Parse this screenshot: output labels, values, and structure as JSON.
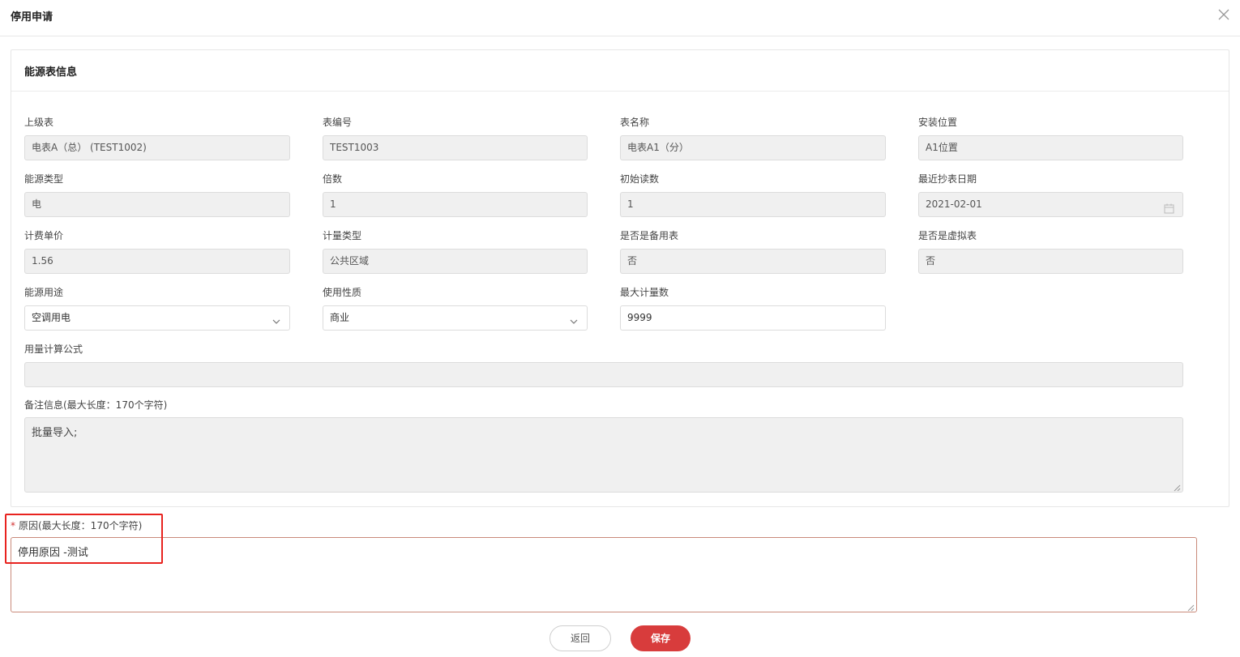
{
  "dialog": {
    "title": "停用申请"
  },
  "section": {
    "title": "能源表信息"
  },
  "fields": {
    "parent_meter": {
      "label": "上级表",
      "value": "电表A（总） (TEST1002)"
    },
    "meter_no": {
      "label": "表编号",
      "value": "TEST1003"
    },
    "meter_name": {
      "label": "表名称",
      "value": "电表A1（分）"
    },
    "location": {
      "label": "安装位置",
      "value": "A1位置"
    },
    "energy_type": {
      "label": "能源类型",
      "value": "电"
    },
    "multiplier": {
      "label": "倍数",
      "value": "1"
    },
    "initial_reading": {
      "label": "初始读数",
      "value": "1"
    },
    "last_read_date": {
      "label": "最近抄表日期",
      "value": "2021-02-01"
    },
    "unit_price": {
      "label": "计费单价",
      "value": "1.56"
    },
    "metering_type": {
      "label": "计量类型",
      "value": "公共区域"
    },
    "is_backup": {
      "label": "是否是备用表",
      "value": "否"
    },
    "is_virtual": {
      "label": "是否是虚拟表",
      "value": "否"
    },
    "energy_use": {
      "label": "能源用途",
      "value": "空调用电"
    },
    "usage_nature": {
      "label": "使用性质",
      "value": "商业"
    },
    "max_count": {
      "label": "最大计量数",
      "value": "9999"
    },
    "formula": {
      "label": "用量计算公式",
      "value": ""
    },
    "remark": {
      "label": "备注信息(最大长度：170个字符)",
      "value": "批量导入;"
    }
  },
  "reason": {
    "required_mark": "*",
    "label": "原因(最大长度：170个字符)",
    "value": "停用原因 -测试"
  },
  "buttons": {
    "back": "返回",
    "save": "保存"
  },
  "icons": {
    "close": "close-icon",
    "dropdown": "chevron-down-icon",
    "calendar": "calendar-icon"
  },
  "colors": {
    "primary": "#d83c3c",
    "highlight": "#e8231f",
    "required": "#d23030"
  }
}
